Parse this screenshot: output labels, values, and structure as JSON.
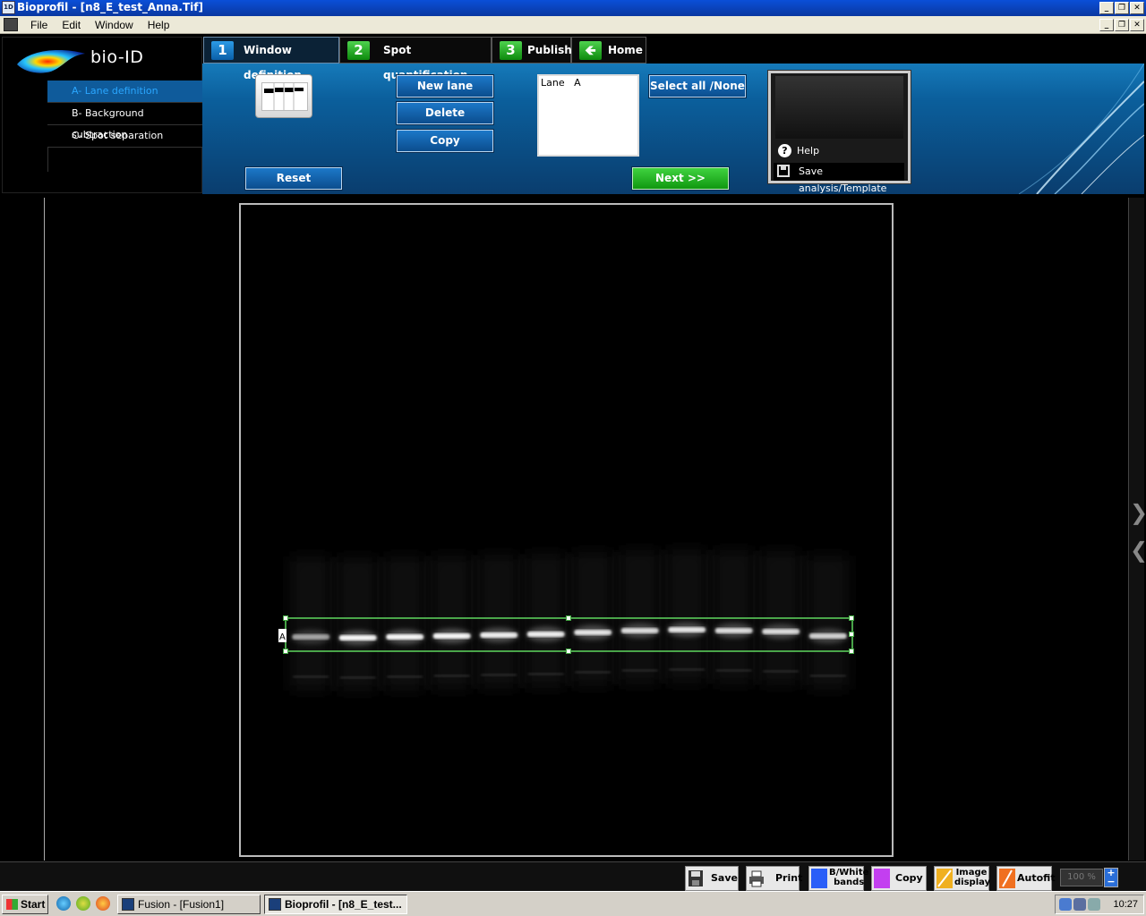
{
  "window": {
    "title": "Bioprofil - [n8_E_test_Anna.Tif]"
  },
  "menubar": {
    "items": [
      "File",
      "Edit",
      "Window",
      "Help"
    ]
  },
  "logo": {
    "text": "bio-ID"
  },
  "steps": [
    {
      "label": "A- Lane definition",
      "active": true
    },
    {
      "label": "B- Background subtraction",
      "active": false
    },
    {
      "label": "C- Spot separation",
      "active": false
    }
  ],
  "tabs": [
    {
      "num": "1",
      "label": "Window definition",
      "active": true
    },
    {
      "num": "2",
      "label": "Spot quantification",
      "active": false
    },
    {
      "num": "3",
      "label": "Publish",
      "active": false
    },
    {
      "num": "",
      "label": "Home",
      "active": false
    }
  ],
  "buttons": {
    "new_lane": "New lane",
    "delete": "Delete",
    "copy": "Copy",
    "reset": "Reset",
    "select_all": "Select all /None",
    "next": "Next  >>"
  },
  "lane_list": {
    "items": [
      "Lane   A"
    ]
  },
  "helpbox": {
    "help": "Help",
    "save": "Save analysis/Template"
  },
  "gel": {
    "lane_label": "A",
    "band_count": 12
  },
  "toolbar": {
    "save": "Save",
    "print": "Print",
    "bw_bands": "B/White bands",
    "copy": "Copy",
    "image_display": "Image display",
    "autofit": "Autofit",
    "zoom": "100 %"
  },
  "taskbar": {
    "start": "Start",
    "tasks": [
      {
        "label": "Fusion - [Fusion1]",
        "active": false
      },
      {
        "label": "Bioprofil - [n8_E_test...",
        "active": true
      }
    ],
    "clock": "10:27"
  },
  "colors": {
    "accent": "#0b5f9c",
    "next_green": "#109810",
    "selection": "#5fd85f"
  }
}
